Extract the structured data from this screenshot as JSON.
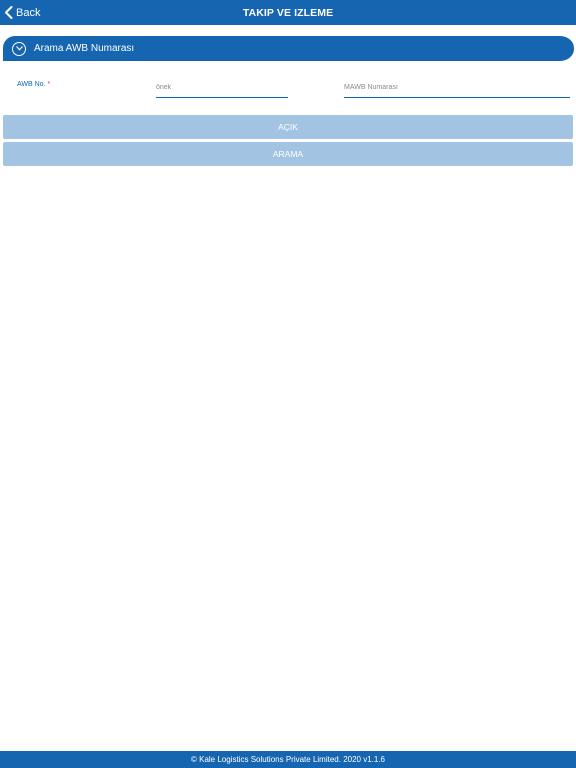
{
  "header": {
    "back_label": "Back",
    "title": "TAKIP VE IZLEME",
    "back_icon": "chevron-left-icon"
  },
  "section": {
    "title": "Arama AWB Numarası",
    "toggle_icon": "chevron-down-circle-icon"
  },
  "form": {
    "awb_label": "AWB No.",
    "required_marker": "*",
    "prefix_placeholder": "önek",
    "prefix_value": "",
    "mawb_placeholder": "MAWB Numarası",
    "mawb_value": ""
  },
  "buttons": {
    "open_label": "AÇIK",
    "search_label": "ARAMA"
  },
  "footer": {
    "text": "© Kale Logistics Solutions Private Limited. 2020 v1.1.6"
  },
  "colors": {
    "primary": "#1565b0",
    "button_disabled": "#a2c4e2",
    "required": "#e03a2f"
  }
}
